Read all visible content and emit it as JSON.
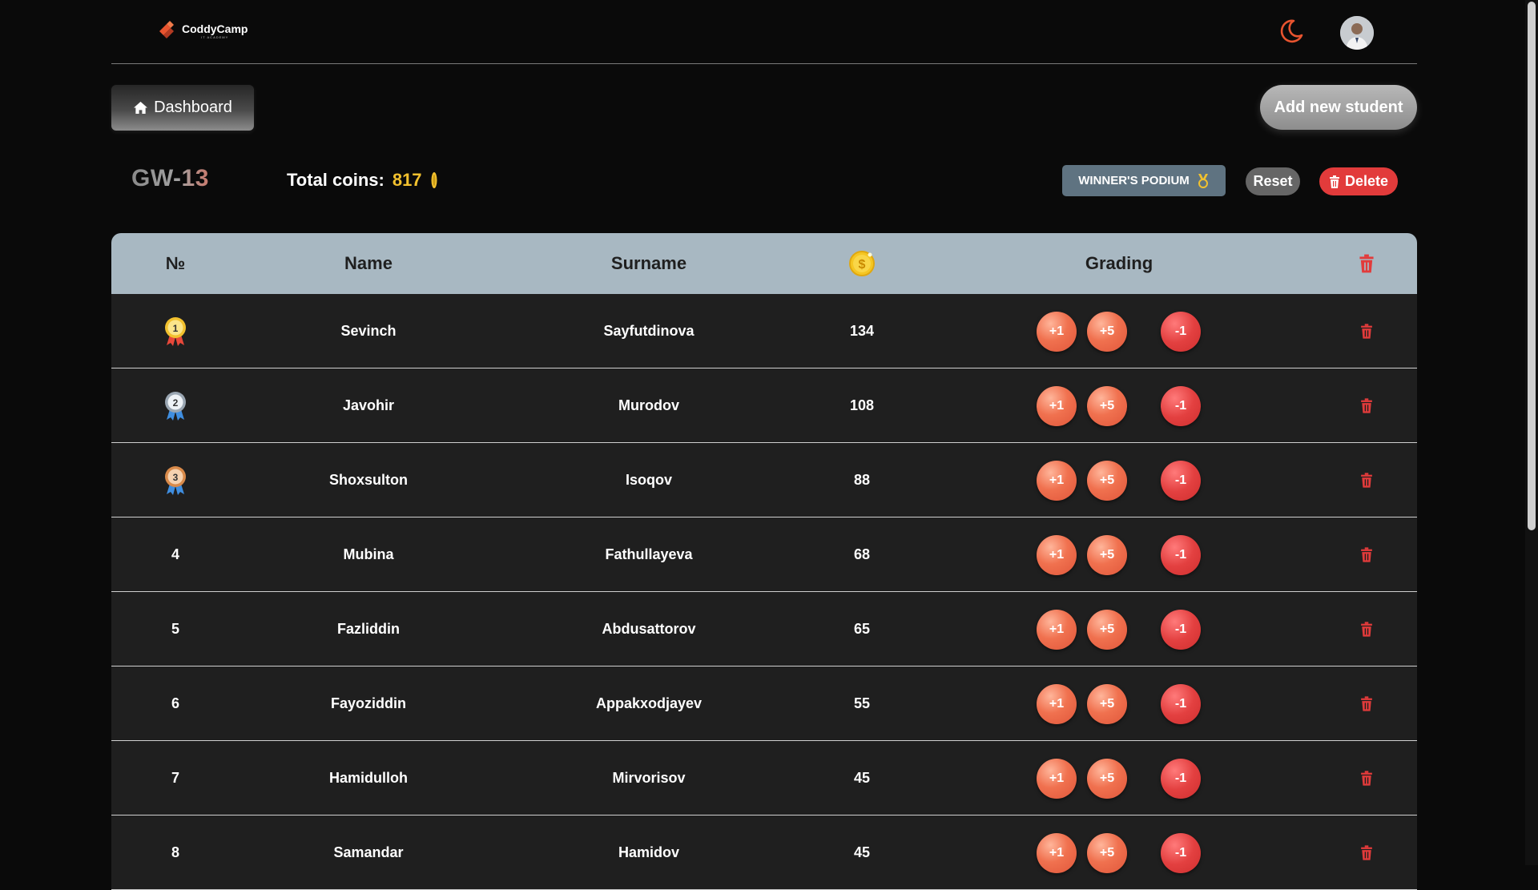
{
  "header": {
    "logo_name": "CoddyCamp",
    "logo_sub": "IT ACADEMY",
    "accent": "#e8542f"
  },
  "toolbar": {
    "dashboard_label": "Dashboard",
    "add_student_label": "Add new student"
  },
  "group": {
    "name": "GW-13",
    "total_label": "Total coins:",
    "total_value": "817",
    "podium_label": "WINNER'S PODIUM",
    "reset_label": "Reset",
    "delete_label": "Delete"
  },
  "table": {
    "headers": {
      "num": "№",
      "name": "Name",
      "surname": "Surname",
      "coin": "coin-icon",
      "grading": "Grading",
      "delete": "trash-icon"
    },
    "grade_buttons": {
      "plus_one": "+1",
      "plus_five": "+5",
      "minus_one": "-1"
    },
    "rows": [
      {
        "rank": "1",
        "medal": "gold",
        "name": "Sevinch",
        "surname": "Sayfutdinova",
        "coins": "134"
      },
      {
        "rank": "2",
        "medal": "silver",
        "name": "Javohir",
        "surname": "Murodov",
        "coins": "108"
      },
      {
        "rank": "3",
        "medal": "bronze",
        "name": "Shoxsulton",
        "surname": "Isoqov",
        "coins": "88"
      },
      {
        "rank": "4",
        "medal": "",
        "name": "Mubina",
        "surname": "Fathullayeva",
        "coins": "68"
      },
      {
        "rank": "5",
        "medal": "",
        "name": "Fazliddin",
        "surname": "Abdusattorov",
        "coins": "65"
      },
      {
        "rank": "6",
        "medal": "",
        "name": "Fayoziddin",
        "surname": "Appakxodjayev",
        "coins": "55"
      },
      {
        "rank": "7",
        "medal": "",
        "name": "Hamidulloh",
        "surname": "Mirvorisov",
        "coins": "45"
      },
      {
        "rank": "8",
        "medal": "",
        "name": "Samandar",
        "surname": "Hamidov",
        "coins": "45"
      }
    ]
  },
  "colors": {
    "danger": "#e23b3b",
    "gold": "#f2c12e",
    "header_bg": "#a8b8c2"
  }
}
